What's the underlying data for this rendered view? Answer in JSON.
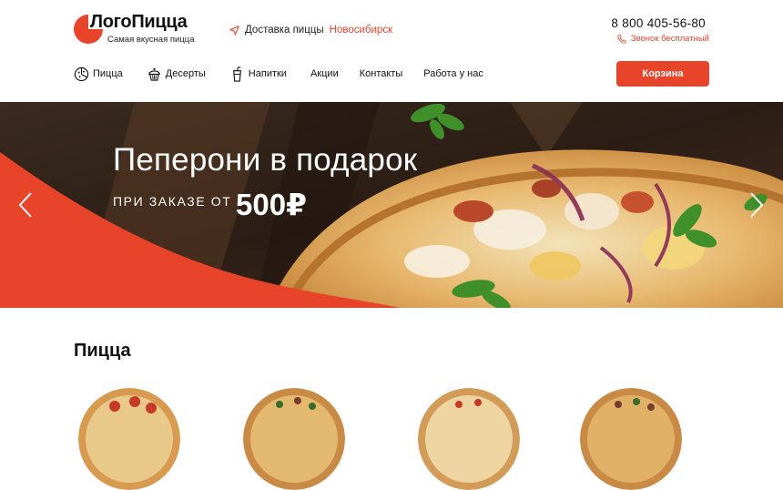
{
  "header": {
    "logo_title": "ЛогоПицца",
    "logo_subtitle": "Самая вкусная пицца",
    "delivery_text": "Доставка пиццы",
    "delivery_city": "Новосибирск",
    "phone": "8 800 405-56-80",
    "call_label": "Звонок бесплатный",
    "cart_label": "Корзина"
  },
  "menu": {
    "items": [
      {
        "label": "Пицца",
        "icon": "pizza-icon"
      },
      {
        "label": "Десерты",
        "icon": "cupcake-icon"
      },
      {
        "label": "Напитки",
        "icon": "drink-icon"
      },
      {
        "label": "Акции"
      },
      {
        "label": "Контакты"
      },
      {
        "label": "Работа у нас"
      }
    ]
  },
  "hero": {
    "title": "Пеперони в подарок",
    "subtitle": "ПРИ ЗАКАЗЕ ОТ",
    "price": "500₽"
  },
  "section": {
    "title": "Пицца"
  },
  "colors": {
    "accent": "#e8442a",
    "text": "#111111"
  }
}
